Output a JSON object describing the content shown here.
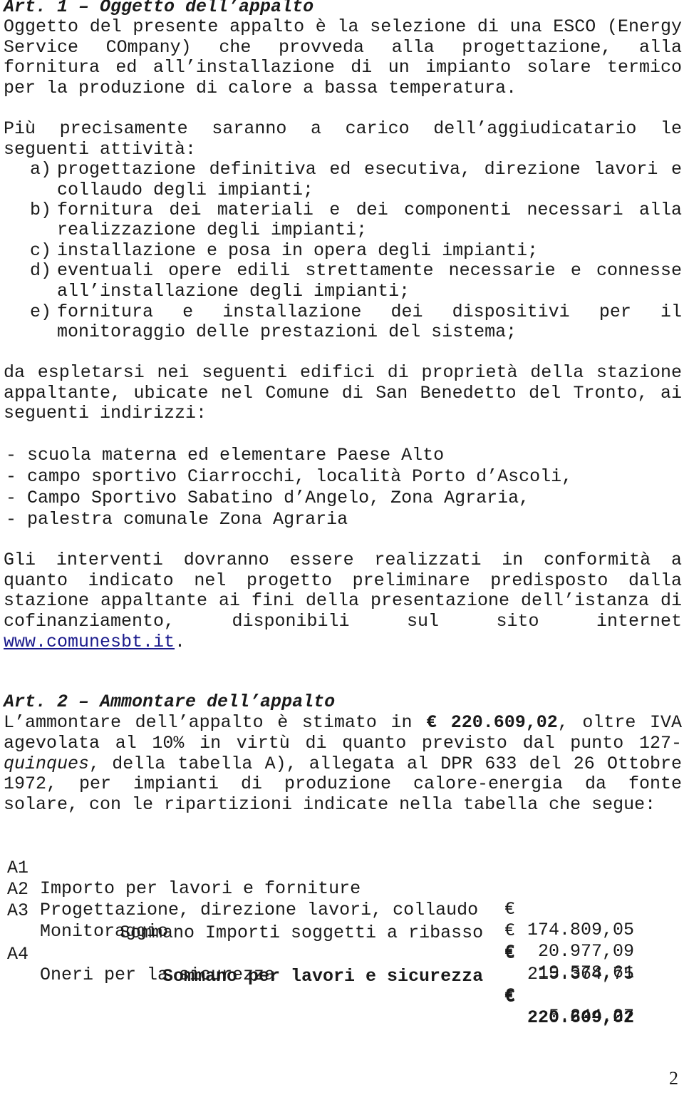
{
  "art1": {
    "title": "Art. 1 – Oggetto dell’appalto",
    "para1": [
      "Oggetto del presente appalto è la selezione di una ESCO (Energy",
      "Service COmpany) che provveda alla progettazione, alla",
      "fornitura ed all’installazione di un impianto solare termico"
    ],
    "para1_last": "per la produzione di calore a bassa temperatura.",
    "para2_first": "Più precisamente saranno a carico dell’aggiudicatario le",
    "para2_second": "seguenti attività:",
    "activities": [
      {
        "label": "a)",
        "lines": [
          "progettazione definitiva ed esecutiva, direzione lavori e"
        ],
        "last": "collaudo degli impianti;"
      },
      {
        "label": "b)",
        "lines": [
          "fornitura dei materiali e dei componenti necessari alla"
        ],
        "last": "realizzazione degli impianti;"
      },
      {
        "label": "c)",
        "lines": [],
        "last": "installazione e posa in opera degli impianti;"
      },
      {
        "label": "d)",
        "lines": [
          "eventuali opere edili strettamente necessarie e connesse"
        ],
        "last": "all’installazione degli impianti;"
      },
      {
        "label": "e)",
        "lines": [
          "fornitura e installazione dei dispositivi per il"
        ],
        "last": "monitoraggio delle prestazioni del sistema;"
      }
    ],
    "para3": [
      "da espletarsi nei seguenti edifici di proprietà della stazione",
      "appaltante, ubicate nel Comune di San Benedetto del Tronto, ai"
    ],
    "para3_last": "seguenti indirizzi:",
    "addresses": [
      "- scuola materna ed elementare Paese Alto",
      "- campo sportivo Ciarrocchi, località Porto d’Ascoli,",
      "- Campo Sportivo Sabatino d’Angelo, Zona Agraria,",
      "- palestra comunale Zona Agraria"
    ],
    "para4": [
      "Gli interventi dovranno essere realizzati in conformità a",
      "quanto indicato nel progetto preliminare predisposto dalla",
      "stazione appaltante ai fini della presentazione dell’istanza di",
      "cofinanziamento, disponibili sul sito internet"
    ],
    "link": "www.comunesbt.it",
    "link_after": "."
  },
  "art2": {
    "title": "Art. 2 – Ammontare dell’appalto",
    "line1_before": "L’ammontare dell’appalto è stimato in",
    "line1_amount": "€ 220.609,02",
    "line1_after": ", oltre IVA",
    "line2": "agevolata al 10% in virtù di quanto previsto dal punto 127-",
    "line3_italic": "quinques",
    "line3_rest": ", della tabella A), allegata al DPR 633 del 26 Ottobre",
    "line4": "1972, per impianti di produzione calore-energia da fonte",
    "line5": "solare, con le ripartizioni indicate nella tabella che segue:",
    "table": [
      {
        "code": "A1",
        "description": "Importo per lavori e forniture",
        "currency": "€",
        "amount": "174.809,05",
        "bold": false,
        "indent": 0
      },
      {
        "code": "A2",
        "description": "Progettazione, direzione lavori, collaudo",
        "currency": "€",
        "amount": "20.977,09",
        "bold": false,
        "indent": 0
      },
      {
        "code": "A3",
        "description": "Monitoraggio",
        "currency": "€",
        "amount": "19.578,61",
        "bold": false,
        "indent": 0
      },
      {
        "code": "",
        "description": "Sommano Importi soggetti a ribasso",
        "currency": "€",
        "amount": "215.364,75",
        "bold": false,
        "indent": 1
      },
      {
        "code": "A4",
        "description": "Oneri per la sicurezza",
        "currency": "€",
        "amount": "5.244,27",
        "bold": false,
        "indent": 0
      },
      {
        "code": "",
        "description": "Sommano per lavori e sicurezza",
        "currency": "€",
        "amount": "220.609,02",
        "bold": true,
        "indent": 2
      }
    ]
  },
  "page_number": "2"
}
